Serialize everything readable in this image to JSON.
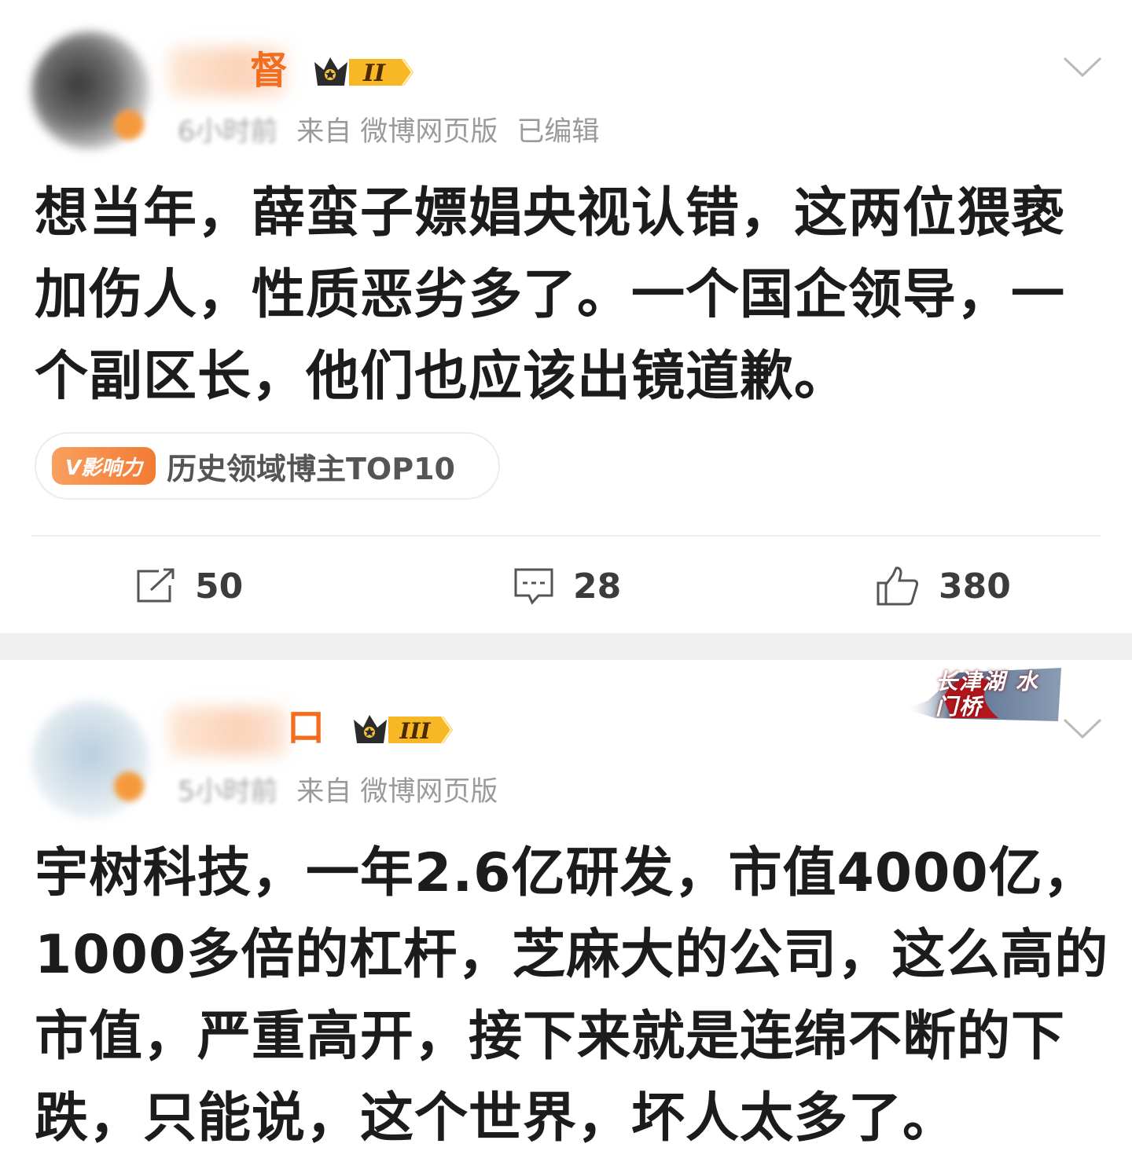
{
  "posts": [
    {
      "username_visible": "督",
      "level": "II",
      "time": "6小时前",
      "source": "来自 微博网页版",
      "edited": "已编辑",
      "text": "想当年，薛蛮子嫖娼央视认错，这两位猥亵加伤人，性质恶劣多了。一个国企领导，一个副区长，他们也应该出镜道歉。",
      "badge": {
        "chip_label": "V影响力",
        "text": "历史领域博主TOP10"
      },
      "actions": {
        "share": "50",
        "comment": "28",
        "like": "380"
      }
    },
    {
      "username_visible": "口",
      "level": "III",
      "time": "5小时前",
      "source": "来自 微博网页版",
      "topic_banner": "长津湖 水门桥",
      "text": "宇树科技，一年2.6亿研发，市值4000亿，1000多倍的杠杆，芝麻大的公司，这么高的市值，严重高开，接下来就是连绵不断的下跌，只能说，这个世界，坏人太多了。"
    }
  ],
  "colors": {
    "username": "#f26d1f",
    "meta": "#9a9a9a",
    "text": "#1c1c1c",
    "badge_chip": "#f27b33",
    "separator": "#efefef"
  },
  "icons": {
    "share": "share-icon",
    "comment": "comment-icon",
    "like": "thumbs-up-icon",
    "more": "chevron-down-icon",
    "vip": "crown-icon"
  }
}
